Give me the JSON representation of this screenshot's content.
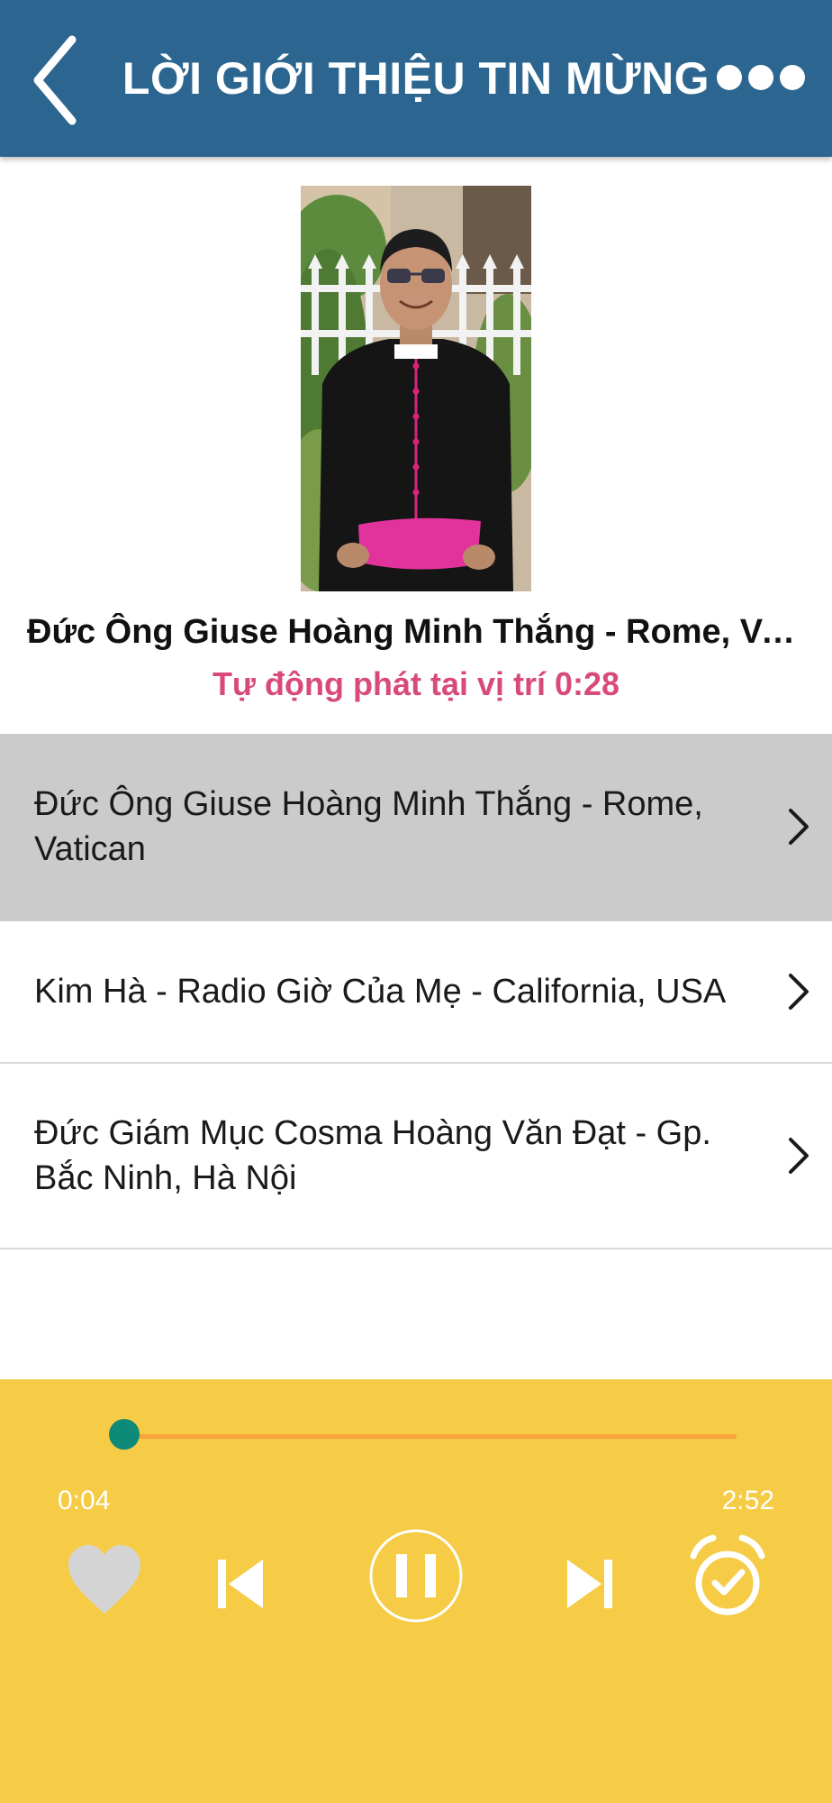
{
  "header": {
    "title": "LỜI GIỚI THIỆU TIN MỪNG",
    "back_icon": "chevron-left-icon",
    "more_icon": "more-horizontal-icon"
  },
  "now_playing": {
    "title": "Đức Ông Giuse Hoàng Minh Thắng - Rome, Vatic…",
    "autoplay_text": "Tự động phát tại vị trí 0:28"
  },
  "list": {
    "items": [
      {
        "label": "Đức Ông Giuse Hoàng Minh Thắng - Rome, Vatican",
        "active": true
      },
      {
        "label": "Kim Hà - Radio Giờ Của Mẹ - California, USA",
        "active": false
      },
      {
        "label": "Đức Giám Mục Cosma Hoàng Văn Đạt - Gp. Bắc Ninh, Hà Nội",
        "active": false
      }
    ]
  },
  "player": {
    "current_time": "0:04",
    "total_time": "2:52",
    "progress": 0.023,
    "controls": [
      "heart-icon",
      "skip-previous-icon",
      "pause-icon",
      "skip-next-icon",
      "alarm-check-icon"
    ]
  },
  "colors": {
    "header_bg": "#2c6690",
    "autoplay_text": "#d94a7c",
    "active_row_bg": "#cbcbcb",
    "player_bg": "#f6cb45",
    "progress_track": "#f7a23a",
    "progress_thumb": "#0d8a78"
  }
}
